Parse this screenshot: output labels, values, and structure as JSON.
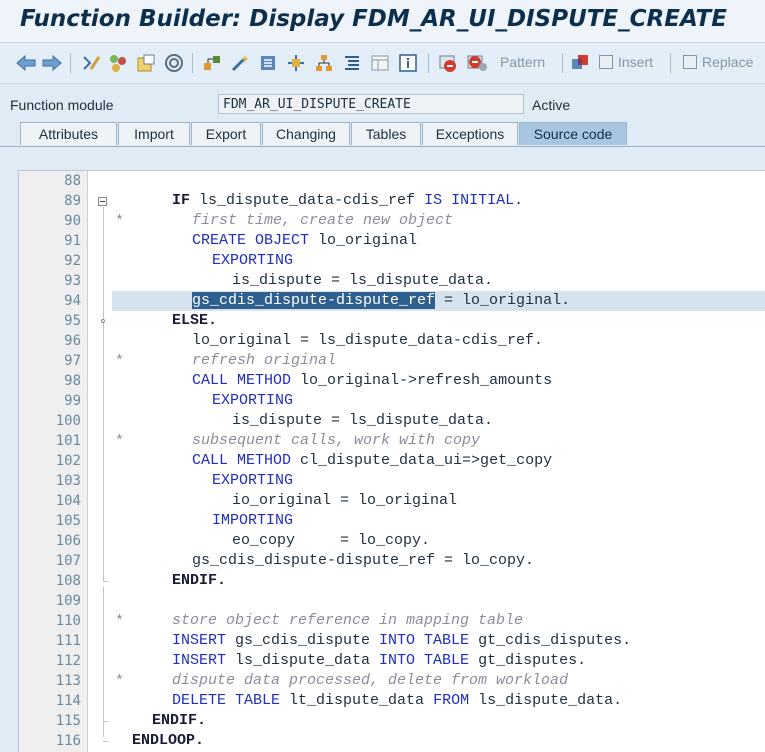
{
  "window": {
    "title": "Function Builder: Display FDM_AR_UI_DISPUTE_CREATE"
  },
  "toolbar": {
    "icons": [
      "back-arrow-icon",
      "forward-arrow-icon",
      "display-change-icon",
      "other-object-icon",
      "activate-icon",
      "test-icon",
      "where-used-icon",
      "object-list-icon",
      "magic-wand-icon",
      "window-icon",
      "hierarchy-icon",
      "pretty-printer-icon",
      "frames-icon",
      "info-icon",
      "breakpoint-icon",
      "session-breakpoint-icon",
      "pattern-icon",
      "insert-icon",
      "replace-icon"
    ],
    "pattern_label": "Pattern",
    "insert_label": "Insert",
    "replace_label": "Replace"
  },
  "function_module": {
    "label": "Function module",
    "value": "FDM_AR_UI_DISPUTE_CREATE",
    "status": "Active"
  },
  "tabs": [
    {
      "label": "Attributes",
      "active": false
    },
    {
      "label": "Import",
      "active": false
    },
    {
      "label": "Export",
      "active": false
    },
    {
      "label": "Changing",
      "active": false
    },
    {
      "label": "Tables",
      "active": false
    },
    {
      "label": "Exceptions",
      "active": false
    },
    {
      "label": "Source code",
      "active": true
    }
  ],
  "editor": {
    "line_numbers": [
      "88",
      "89",
      "90",
      "91",
      "92",
      "93",
      "94",
      "95",
      "96",
      "97",
      "98",
      "99",
      "100",
      "101",
      "102",
      "103",
      "104",
      "105",
      "106",
      "107",
      "108",
      "109",
      "110",
      "111",
      "112",
      "113",
      "114",
      "115",
      "116"
    ],
    "selected_line": "94",
    "lines": [
      "",
      "IF ls_dispute_data-cdis_ref IS INITIAL.",
      "first time, create new object",
      "CREATE OBJECT lo_original",
      "EXPORTING",
      "is_dispute = ls_dispute_data.",
      "gs_cdis_dispute-dispute_ref = lo_original.",
      "ELSE.",
      "lo_original = ls_dispute_data-cdis_ref.",
      "refresh original",
      "CALL METHOD lo_original->refresh_amounts",
      "EXPORTING",
      "is_dispute = ls_dispute_data.",
      "subsequent calls, work with copy",
      "CALL METHOD cl_dispute_data_ui=>get_copy",
      "EXPORTING",
      "io_original = lo_original",
      "IMPORTING",
      "eo_copy     = lo_copy.",
      "gs_cdis_dispute-dispute_ref = lo_copy.",
      "ENDIF.",
      "",
      "store object reference in mapping table",
      "INSERT gs_cdis_dispute INTO TABLE gt_cdis_disputes.",
      "INSERT ls_dispute_data INTO TABLE gt_disputes.",
      "dispute data processed, delete from workload",
      "DELETE TABLE lt_dispute_data FROM ls_dispute_data.",
      "ENDIF.",
      "ENDLOOP."
    ],
    "comment_marker": "*"
  },
  "colors": {
    "keyword": "#1f2fbf",
    "comment": "#8c8c9c",
    "selection": "#2f5f8d"
  }
}
